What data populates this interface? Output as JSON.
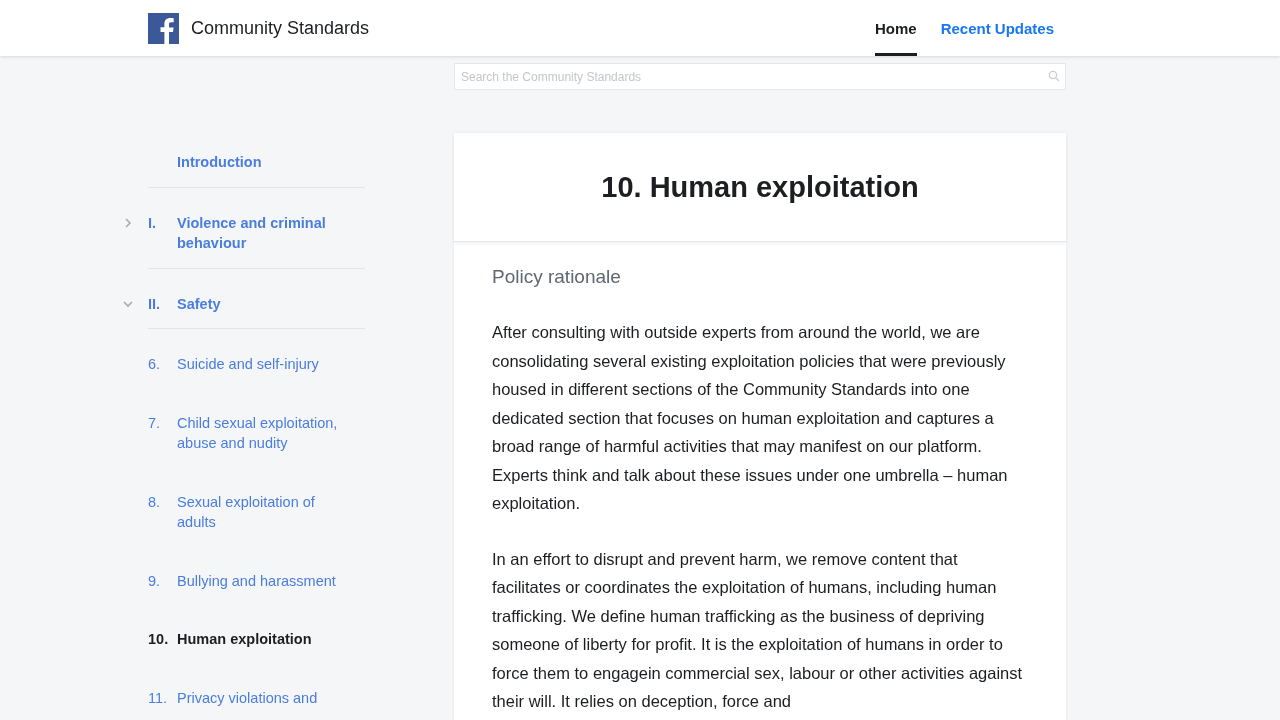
{
  "header": {
    "brand": "Community Standards",
    "nav": [
      {
        "label": "Home",
        "selected": true
      },
      {
        "label": "Recent Updates",
        "selected": false
      }
    ]
  },
  "search": {
    "placeholder": "Search the Community Standards"
  },
  "sidebar": {
    "items": [
      {
        "kind": "intro",
        "label": "Introduction",
        "selected": false
      },
      {
        "kind": "section",
        "number": "I.",
        "label": "Violence and criminal behaviour",
        "expanded": false,
        "selected": false
      },
      {
        "kind": "section",
        "number": "II.",
        "label": "Safety",
        "expanded": true,
        "selected": false
      },
      {
        "kind": "item",
        "number": "6.",
        "label": "Suicide and self-injury",
        "selected": false
      },
      {
        "kind": "item",
        "number": "7.",
        "label": "Child sexual exploitation, abuse and nudity",
        "selected": false
      },
      {
        "kind": "item",
        "number": "8.",
        "label": "Sexual exploitation of adults",
        "selected": false
      },
      {
        "kind": "item",
        "number": "9.",
        "label": "Bullying and harassment",
        "selected": false
      },
      {
        "kind": "item",
        "number": "10.",
        "label": "Human exploitation",
        "selected": true
      },
      {
        "kind": "item",
        "number": "11.",
        "label": "Privacy violations and",
        "selected": false
      }
    ]
  },
  "article": {
    "title": "10. Human exploitation",
    "subtitle": "Policy rationale",
    "paragraphs": [
      "After consulting with outside experts from around the world, we are consolidating several existing exploitation policies that were previously housed in different sections of the Community Standards into one dedicated section that focuses on human exploitation and captures a broad range of harmful activities that may manifest on our platform. Experts think and talk about these issues under one umbrella – human exploitation.",
      "In an effort to disrupt and prevent harm, we remove content that facilitates or coordinates the exploitation of humans, including human trafficking. We define human trafficking as the business of depriving someone of liberty for profit. It is the exploitation of humans in order to force them to engagein commercial sex, labour or other activities against their will. It relies on deception, force and"
    ]
  }
}
